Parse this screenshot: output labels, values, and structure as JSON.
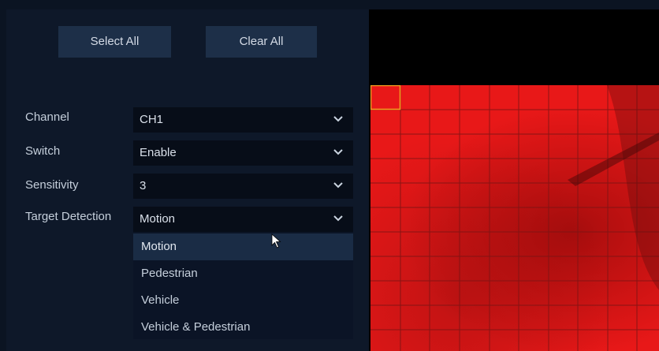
{
  "actions": {
    "select_all": "Select All",
    "clear_all": "Clear All"
  },
  "form": {
    "channel": {
      "label": "Channel",
      "value": "CH1"
    },
    "switch": {
      "label": "Switch",
      "value": "Enable"
    },
    "sensitivity": {
      "label": "Sensitivity",
      "value": "3"
    },
    "target_detection": {
      "label": "Target Detection",
      "value": "Motion"
    }
  },
  "dropdown": {
    "options": [
      "Motion",
      "Pedestrian",
      "Vehicle",
      "Vehicle & Pedestrian"
    ],
    "selected": "Motion"
  },
  "motion_grid": {
    "highlight_color": "#e81818",
    "grid_line_color": "#8a1a1a",
    "selected_cell_color": "#f0a020"
  },
  "icons": {
    "chevron": "chevron-down-icon",
    "cursor": "mouse-pointer-icon"
  }
}
